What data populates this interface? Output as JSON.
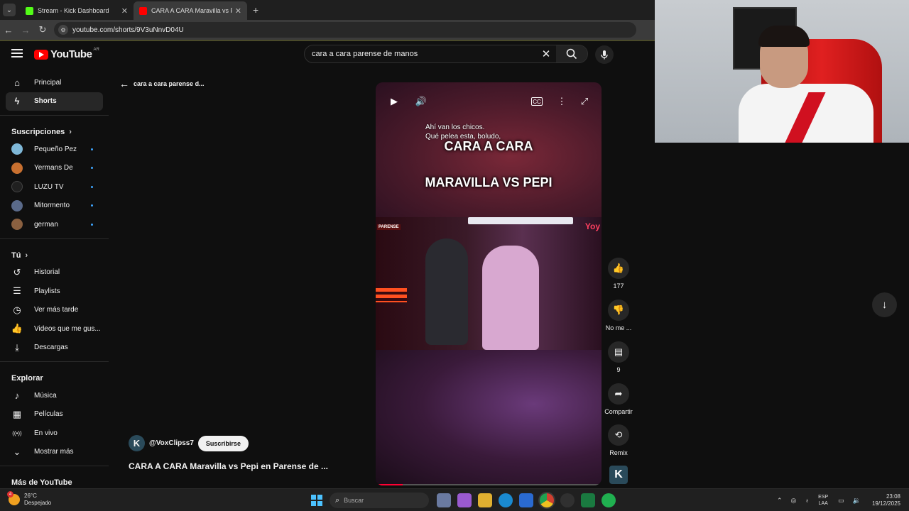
{
  "browser": {
    "tabs": [
      {
        "title": "Stream - Kick Dashboard",
        "favicon_color": "#53fc18",
        "favicon_letter": "K",
        "active": false
      },
      {
        "title": "CARA A CARA Maravilla vs Pepi",
        "favicon_color": "#ff0000",
        "favicon_letter": "▶",
        "active": true
      }
    ],
    "new_tab": "+",
    "close": "✕",
    "url": "youtube.com/shorts/9V3uNnvD04U"
  },
  "youtube": {
    "logo_text": "YouTube",
    "country": "AR",
    "search_query": "cara a cara parense de manos",
    "search_clear": "✕"
  },
  "sidebar": {
    "main": [
      {
        "label": "Principal",
        "icon": "home-icon",
        "glyph": "⌂",
        "selected": false
      },
      {
        "label": "Shorts",
        "icon": "shorts-icon",
        "glyph": "ϟ",
        "selected": true
      }
    ],
    "subs_header": "Suscripciones",
    "subscriptions": [
      {
        "label": "Pequeño Pez",
        "color": "#7fb8d8"
      },
      {
        "label": "Yermans De",
        "color": "#c87030"
      },
      {
        "label": "LUZU TV",
        "color": "#202020"
      },
      {
        "label": "Mitormento",
        "color": "#5a6a8a"
      },
      {
        "label": "german",
        "color": "#8a6040"
      }
    ],
    "you_header": "Tú",
    "you_items": [
      {
        "label": "Historial",
        "icon": "history-icon",
        "glyph": "↺"
      },
      {
        "label": "Playlists",
        "icon": "playlists-icon",
        "glyph": "☰"
      },
      {
        "label": "Ver más tarde",
        "icon": "watch-later-icon",
        "glyph": "◷"
      },
      {
        "label": "Videos que me gus...",
        "icon": "liked-icon",
        "glyph": "👍"
      },
      {
        "label": "Descargas",
        "icon": "download-icon",
        "glyph": "⤓"
      }
    ],
    "explore_header": "Explorar",
    "explore_items": [
      {
        "label": "Música",
        "icon": "music-icon",
        "glyph": "♪"
      },
      {
        "label": "Películas",
        "icon": "movies-icon",
        "glyph": "▦"
      },
      {
        "label": "En vivo",
        "icon": "live-icon",
        "glyph": "((•))"
      },
      {
        "label": "Mostrar más",
        "icon": "chevron-down-icon",
        "glyph": "⌄"
      }
    ],
    "more_header": "Más de YouTube"
  },
  "shorts": {
    "back_label": "cara a cara parense d...",
    "subtitle_lines": [
      "Ahí van los chicos.",
      "Qué pelea esta, boludo,"
    ],
    "caption_top": "CARA A CARA",
    "caption_bottom": "MARAVILLA VS PEPI",
    "brand_left": "PARENSE",
    "brand_right": "Yoy",
    "progress": 0.12,
    "channel_letter": "K",
    "channel_handle": "@VoxClipss7",
    "subscribe_label": "Suscribirse",
    "video_title": "CARA A CARA Maravilla vs Pepi en Parense de ...",
    "actions": [
      {
        "name": "like",
        "glyph": "👍",
        "label": "177"
      },
      {
        "name": "dislike",
        "glyph": "👎",
        "label": "No me ..."
      },
      {
        "name": "comments",
        "glyph": "▤",
        "label": "9"
      },
      {
        "name": "share",
        "glyph": "➦",
        "label": "Compartir"
      },
      {
        "name": "remix",
        "glyph": "⟲",
        "label": "Remix"
      }
    ],
    "next_glyph": "↓"
  },
  "taskbar": {
    "weather_temp": "26°C",
    "weather_desc": "Despejado",
    "weather_badge": "4",
    "search_placeholder": "Buscar",
    "lang_top": "ESP",
    "lang_bottom": "LAA",
    "time": "23:08",
    "date": "19/12/2025",
    "apps": [
      {
        "name": "widgets",
        "color": "#6a7aa0"
      },
      {
        "name": "copilot",
        "color": "#9a5ad0"
      },
      {
        "name": "explorer",
        "color": "#e0b030"
      },
      {
        "name": "edge",
        "color": "#1a8ad0"
      },
      {
        "name": "store",
        "color": "#2a6ad0"
      },
      {
        "name": "chrome",
        "color": "#d04030"
      },
      {
        "name": "obs",
        "color": "#303030"
      },
      {
        "name": "excel",
        "color": "#1a7a40"
      },
      {
        "name": "whatsapp",
        "color": "#20b050"
      }
    ]
  }
}
